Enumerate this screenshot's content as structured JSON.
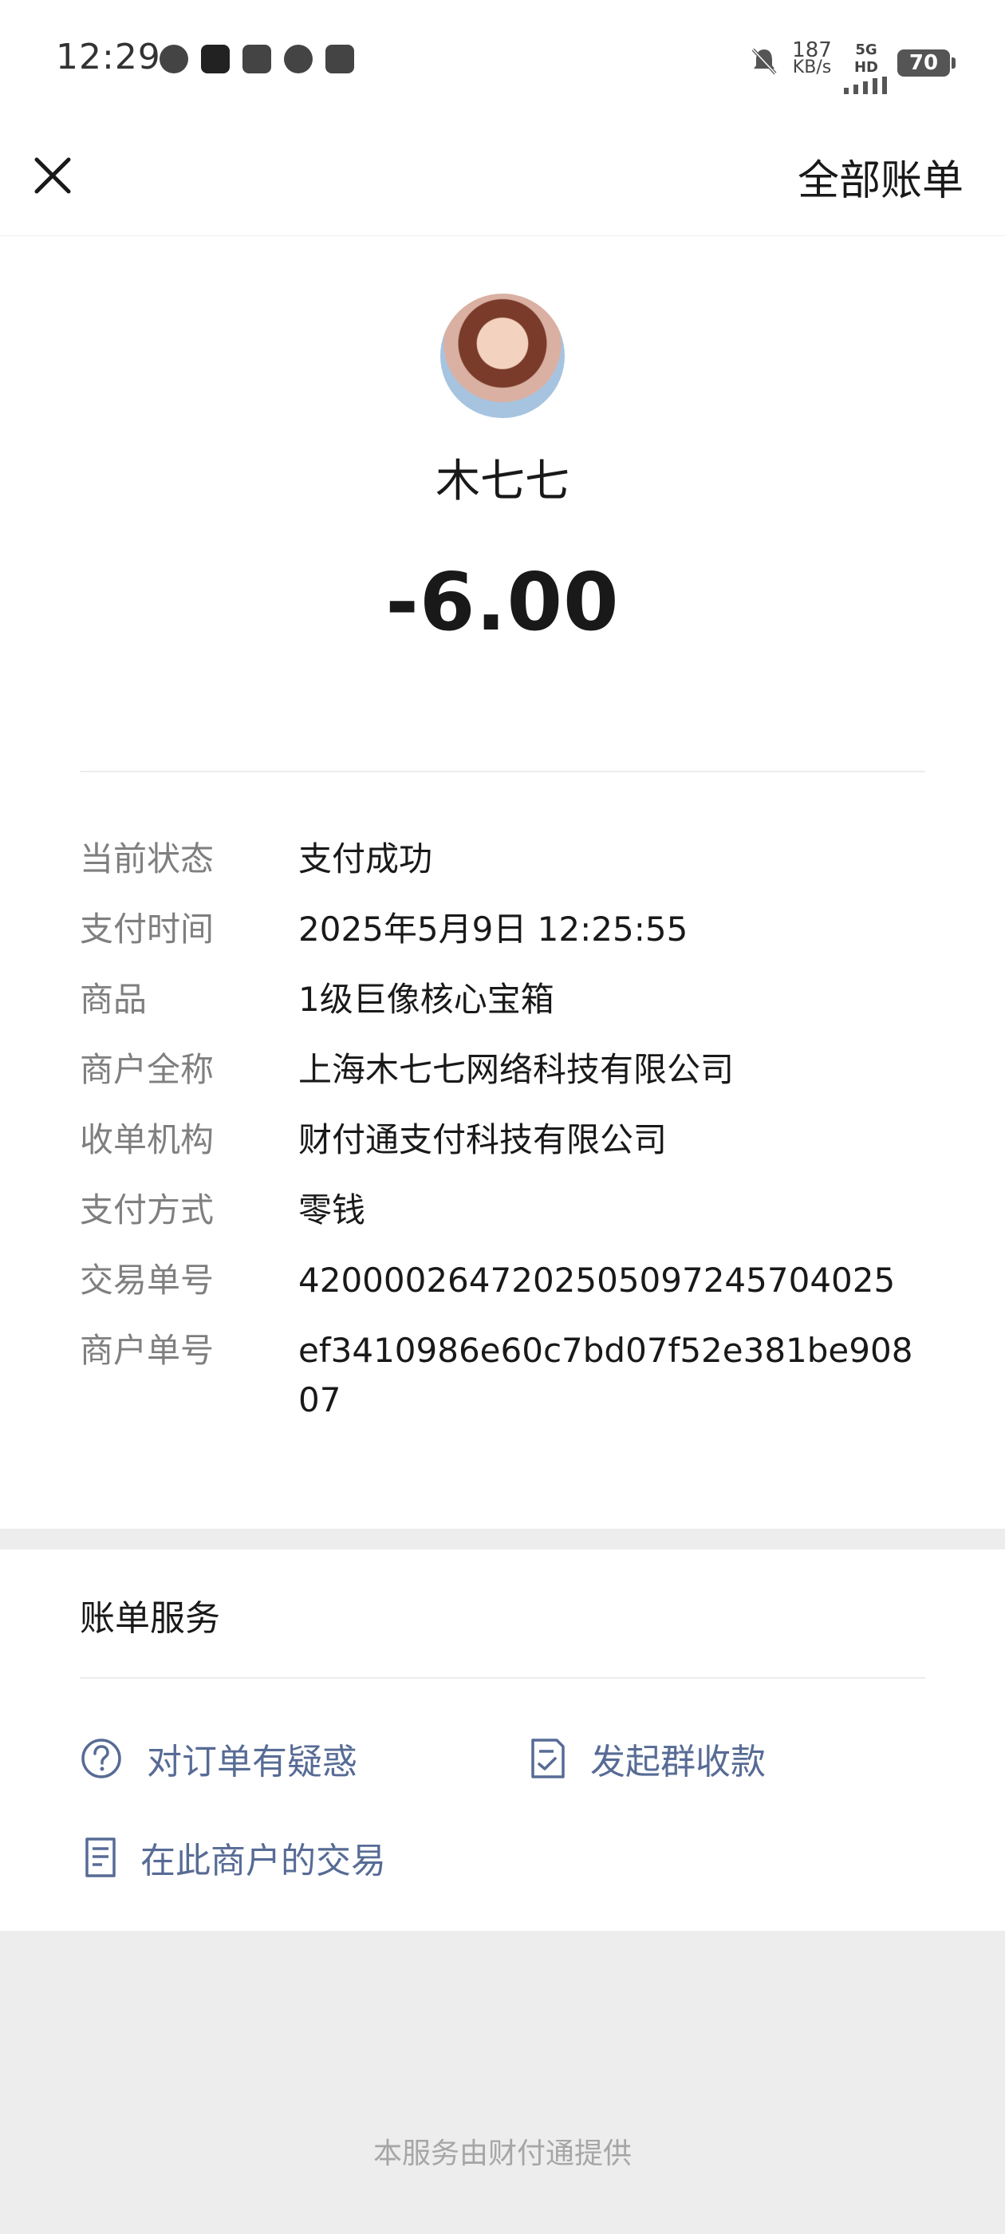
{
  "status_bar": {
    "time": "12:29",
    "speed_value": "187",
    "speed_unit": "KB/s",
    "network": "5G HD",
    "battery": "70"
  },
  "header": {
    "all_bills_label": "全部账单"
  },
  "transaction": {
    "merchant_name": "木七七",
    "amount": "-6.00"
  },
  "details": [
    {
      "label": "当前状态",
      "value": "支付成功"
    },
    {
      "label": "支付时间",
      "value": "2025年5月9日 12:25:55"
    },
    {
      "label": "商品",
      "value": "1级巨像核心宝箱"
    },
    {
      "label": "商户全称",
      "value": "上海木七七网络科技有限公司"
    },
    {
      "label": "收单机构",
      "value": "财付通支付科技有限公司"
    },
    {
      "label": "支付方式",
      "value": "零钱"
    },
    {
      "label": "交易单号",
      "value": "4200002647202505097245704025"
    },
    {
      "label": "商户单号",
      "value": "ef3410986e60c7bd07f52e381be90807"
    }
  ],
  "service": {
    "title": "账单服务",
    "question_label": "对订单有疑惑",
    "group_collect_label": "发起群收款",
    "merchant_history_label": "在此商户的交易"
  },
  "footer": {
    "text": "本服务由财付通提供"
  },
  "colors": {
    "link": "#576b95",
    "label_gray": "#7f7f7f",
    "page_bg": "#ededed"
  }
}
